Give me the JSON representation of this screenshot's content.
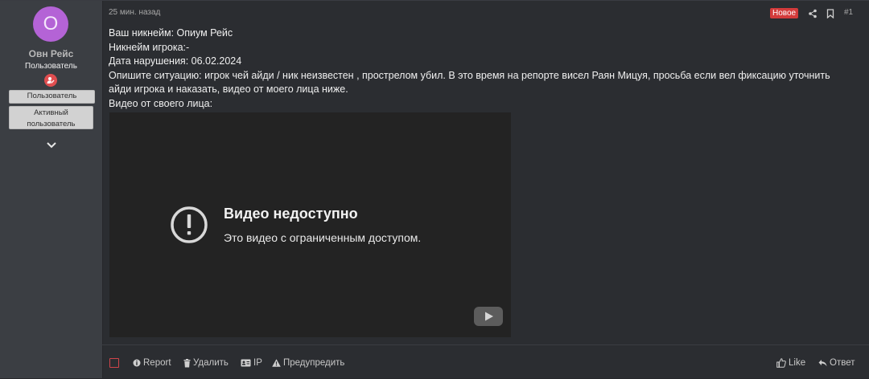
{
  "user": {
    "avatar_letter": "O",
    "avatar_color": "#b463d6",
    "name": "Овн Рейс",
    "title": "Пользователь",
    "role_icon": "user-edit-icon",
    "banners": [
      "Пользователь",
      "Активный пользователь"
    ]
  },
  "post": {
    "time": "25 мин. назад",
    "new_badge": "Новое",
    "number": "#1",
    "lines": [
      "Ваш никнейм: Опиум Рейс",
      "Никнейм игрока:-",
      "Дата нарушения: 06.02.2024",
      "Опишите ситуацию: игрок чей айди / ник неизвестен , прострелом убил. В это время на репорте висел Раян Мицуя, просьба если вел фиксацию уточнить",
      "айди игрока и наказать, видео от моего лица ниже.",
      "Видео от своего лица:"
    ]
  },
  "video": {
    "title": "Видео недоступно",
    "message": "Это видео с ограниченным доступом."
  },
  "actions": {
    "report": "Report",
    "delete": "Удалить",
    "ip": "IP",
    "warn": "Предупредить",
    "like": "Like",
    "reply": "Ответ"
  }
}
